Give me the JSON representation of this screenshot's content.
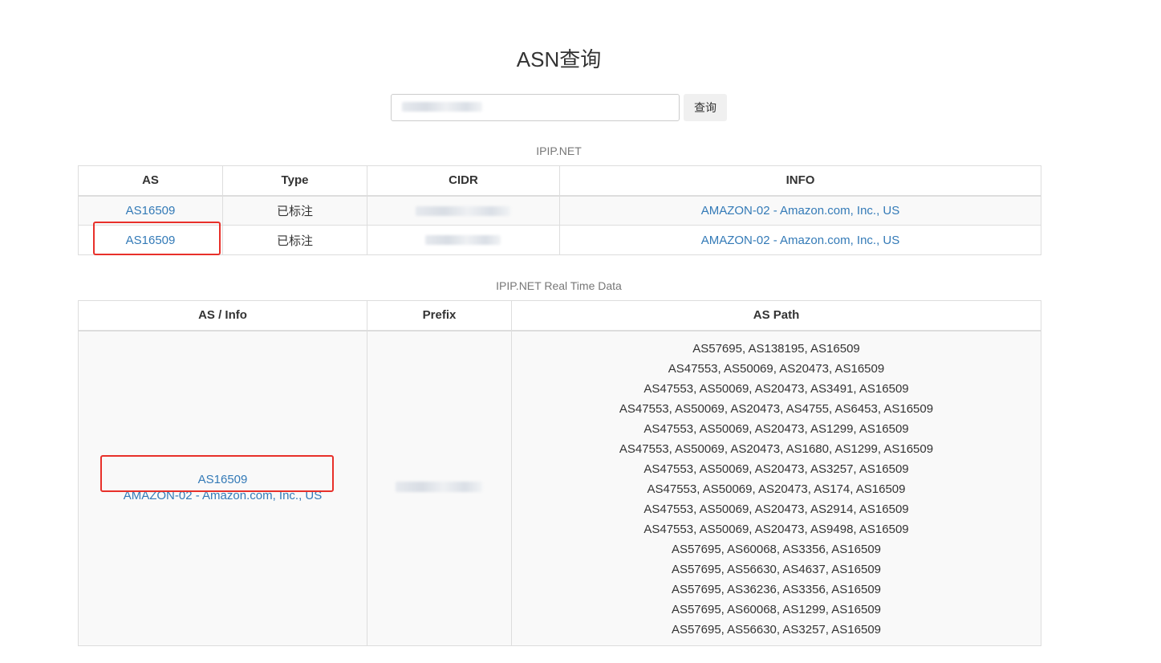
{
  "page": {
    "title": "ASN查询"
  },
  "search": {
    "value": "",
    "button_label": "查询"
  },
  "ipip_table": {
    "caption": "IPIP.NET",
    "headers": [
      "AS",
      "Type",
      "CIDR",
      "INFO"
    ],
    "rows": [
      {
        "as": "AS16509",
        "type": "已标注",
        "cidr": "",
        "info": "AMAZON-02 - Amazon.com, Inc., US"
      },
      {
        "as": "AS16509",
        "type": "已标注",
        "cidr": "",
        "info": "AMAZON-02 - Amazon.com, Inc., US"
      }
    ]
  },
  "realtime_table": {
    "caption": "IPIP.NET Real Time Data",
    "headers": [
      "AS / Info",
      "Prefix",
      "AS Path"
    ],
    "row": {
      "as": "AS16509",
      "info": "AMAZON-02 - Amazon.com, Inc., US",
      "prefix": "",
      "paths": [
        "AS57695, AS138195, AS16509",
        "AS47553, AS50069, AS20473, AS16509",
        "AS47553, AS50069, AS20473, AS3491, AS16509",
        "AS47553, AS50069, AS20473, AS4755, AS6453, AS16509",
        "AS47553, AS50069, AS20473, AS1299, AS16509",
        "AS47553, AS50069, AS20473, AS1680, AS1299, AS16509",
        "AS47553, AS50069, AS20473, AS3257, AS16509",
        "AS47553, AS50069, AS20473, AS174, AS16509",
        "AS47553, AS50069, AS20473, AS2914, AS16509",
        "AS47553, AS50069, AS20473, AS9498, AS16509",
        "AS57695, AS60068, AS3356, AS16509",
        "AS57695, AS56630, AS4637, AS16509",
        "AS57695, AS36236, AS3356, AS16509",
        "AS57695, AS60068, AS1299, AS16509",
        "AS57695, AS56630, AS3257, AS16509"
      ]
    }
  },
  "colors": {
    "link": "#337ab7",
    "annotation": "#e8302a",
    "stripe": "#f9f9f9",
    "border": "#dddddd"
  }
}
